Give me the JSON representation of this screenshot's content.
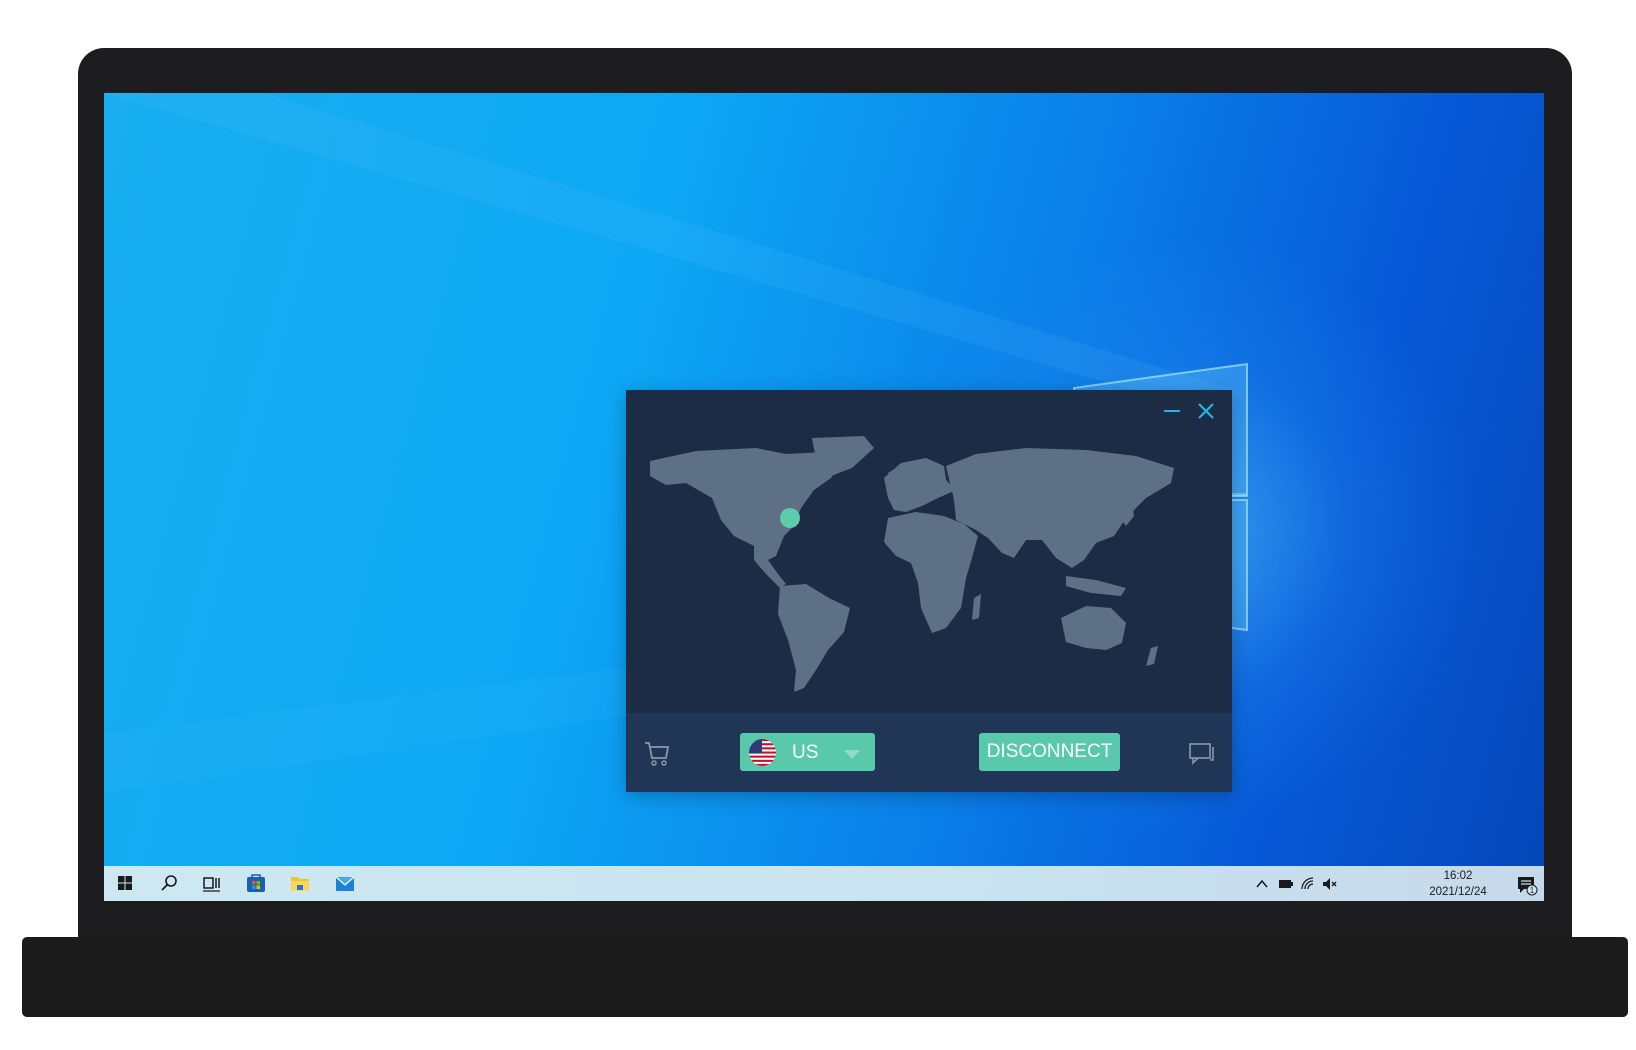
{
  "vpn": {
    "titlebar": {
      "minimize_icon": "minimize-icon",
      "close_icon": "close-icon"
    },
    "server_location": {
      "name": "United States",
      "marker_color": "#5ecbaa"
    },
    "country_select": {
      "value": "US",
      "flag_icon": "us-flag-icon",
      "caret_icon": "caret-down-icon"
    },
    "disconnect_label": "DISCONNECT",
    "cart_icon": "cart-icon",
    "chat_icon": "chat-icon",
    "colors": {
      "window_bg": "#1c2c45",
      "bar_bg": "#213656",
      "accent": "#59c9ab",
      "land": "#5d7085"
    }
  },
  "taskbar": {
    "icons": [
      "windows-start-icon",
      "search-icon",
      "task-view-icon",
      "store-icon",
      "file-explorer-icon",
      "mail-icon"
    ],
    "tray": [
      "chevron-up-icon",
      "battery-icon",
      "wifi-icon",
      "volume-muted-icon"
    ],
    "time": "16:02",
    "date": "2021/12/24",
    "notification_count": "1"
  }
}
